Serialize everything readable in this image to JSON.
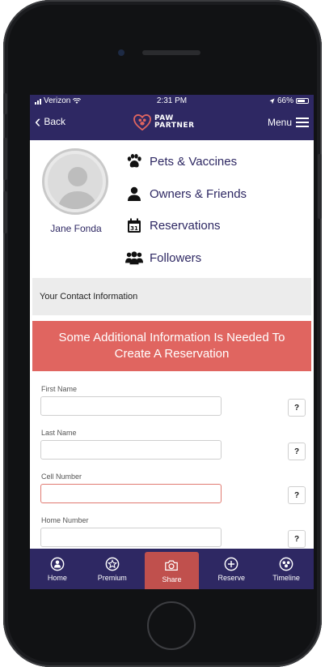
{
  "status_bar": {
    "carrier": "Verizon",
    "time": "2:31 PM",
    "battery": "66%"
  },
  "navbar": {
    "back_label": "Back",
    "logo_line1": "PAW",
    "logo_line2": "PARTNER",
    "menu_label": "Menu"
  },
  "profile": {
    "name": "Jane Fonda",
    "links": [
      {
        "label": "Pets & Vaccines",
        "icon": "paw-icon"
      },
      {
        "label": "Owners & Friends",
        "icon": "person-icon"
      },
      {
        "label": "Reservations",
        "icon": "calendar-icon"
      },
      {
        "label": "Followers",
        "icon": "group-icon"
      }
    ],
    "calendar_day": "31"
  },
  "contact": {
    "heading": "Your Contact Information"
  },
  "alert": {
    "message": "Some Additional Information Is Needed To Create A Reservation"
  },
  "form": {
    "fields": [
      {
        "label": "First Name",
        "value": "",
        "help": "?"
      },
      {
        "label": "Last Name",
        "value": "",
        "help": "?"
      },
      {
        "label": "Cell Number",
        "value": "",
        "help": "?"
      },
      {
        "label": "Home Number",
        "value": "",
        "help": "?"
      }
    ]
  },
  "tabbar": {
    "tabs": [
      {
        "label": "Home",
        "icon": "home-icon"
      },
      {
        "label": "Premium",
        "icon": "star-icon"
      },
      {
        "label": "Share",
        "icon": "camera-icon",
        "active": true
      },
      {
        "label": "Reserve",
        "icon": "plus-circle-icon"
      },
      {
        "label": "Timeline",
        "icon": "timeline-icon"
      }
    ]
  },
  "colors": {
    "brand": "#2e2863",
    "alert": "#e06560",
    "active_tab": "#c0504d",
    "error_border": "#e07a72"
  }
}
